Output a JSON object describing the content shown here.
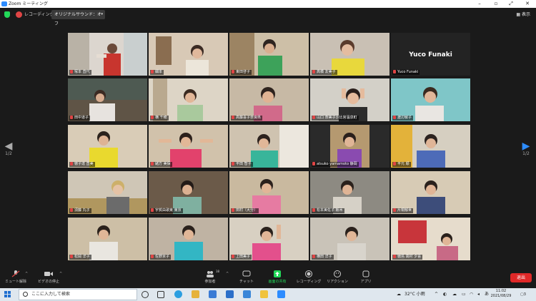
{
  "window": {
    "title": "Zoom ミーティング",
    "controls": [
      "–",
      "▫",
      "⤢",
      "✕"
    ]
  },
  "topbar": {
    "recording_label": "レコーディング中",
    "sound_button": "オリジナルサウンド：オフ",
    "sound_caret": "▾",
    "view_label": "表示"
  },
  "nav": {
    "left_page": "1/2",
    "right_page": "1/2",
    "left_arrow": "◀",
    "right_arrow": "▶"
  },
  "participants": [
    {
      "name": "塚本 直代"
    },
    {
      "name": "細本"
    },
    {
      "name": "東田啓子"
    },
    {
      "name": "高橋 友美子"
    },
    {
      "name": "Yuco Funaki",
      "display": "Yuco Funaki"
    },
    {
      "name": "田中道子"
    },
    {
      "name": "横 千穂"
    },
    {
      "name": "高藤喜子奈良県"
    },
    {
      "name": "山口 奈美子沙比宮温泉町"
    },
    {
      "name": "渡辺敏子"
    },
    {
      "name": "徳子達 直美"
    },
    {
      "name": "緒方 美保"
    },
    {
      "name": "平田 智子"
    },
    {
      "name": "atsuko yamamoto 静岡"
    },
    {
      "name": "平元 順"
    },
    {
      "name": "須藤 丸子"
    },
    {
      "name": "宇賀由歌東 東京"
    },
    {
      "name": "田村（大分）"
    },
    {
      "name": "松本美佐子 栃木"
    },
    {
      "name": "片桐郁世"
    },
    {
      "name": "松岡 洋子"
    },
    {
      "name": "佐野京子"
    },
    {
      "name": "上田美子"
    },
    {
      "name": "横田 洋子"
    },
    {
      "name": "徳島 高村 夕喜"
    }
  ],
  "controls": {
    "mute": "ミュート解除",
    "video": "ビデオの停止",
    "participants": "参加者",
    "participants_count": "38",
    "chat": "チャット",
    "share": "画面の共有",
    "record": "レコーディング",
    "reactions": "リアクション",
    "apps": "アプリ",
    "end": "退出",
    "caret": "^"
  },
  "taskbar": {
    "search_placeholder": "ここに入力して検索",
    "weather": "32°C 小雨",
    "ime": "あ",
    "time": "11:02",
    "date": "2021/08/29",
    "notification_count": "3"
  },
  "colors": {
    "zoom_blue": "#2d8cff",
    "active_speaker": "#b7dc3a",
    "end_red": "#e02828",
    "share_green": "#23d959"
  }
}
